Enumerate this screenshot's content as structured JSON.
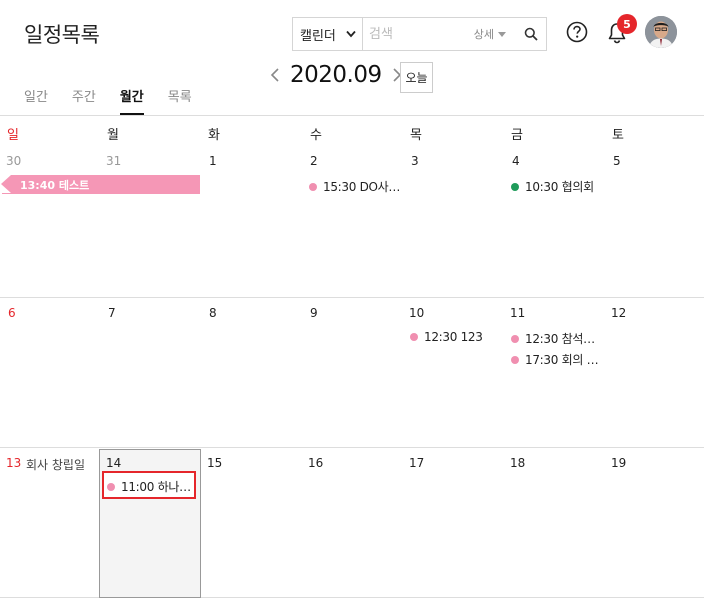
{
  "header": {
    "title": "일정목록",
    "search_scope": "캘린더",
    "search_placeholder": "검색",
    "detail_label": "상세",
    "notification_count": "5"
  },
  "tabs": [
    {
      "label": "일간",
      "active": false
    },
    {
      "label": "주간",
      "active": false
    },
    {
      "label": "월간",
      "active": true
    },
    {
      "label": "목록",
      "active": false
    }
  ],
  "nav": {
    "month": "2020.09",
    "today_label": "오늘"
  },
  "weekdays": [
    "일",
    "월",
    "화",
    "수",
    "목",
    "금",
    "토"
  ],
  "weeks": [
    {
      "days": [
        "30",
        "31",
        "1",
        "2",
        "3",
        "4",
        "5"
      ],
      "bar_event": "13:40 테스트",
      "events": [
        {
          "text": "15:30 DO사…",
          "color": "pink"
        },
        {
          "text": "10:30 협의회",
          "color": "green"
        }
      ]
    },
    {
      "days": [
        "6",
        "7",
        "8",
        "9",
        "10",
        "11",
        "12"
      ],
      "events": [
        {
          "text": "12:30 123",
          "color": "pink"
        },
        {
          "text": "12:30 참석…",
          "color": "pink"
        },
        {
          "text": "17:30 회의 …",
          "color": "pink"
        }
      ]
    },
    {
      "days": [
        "13",
        "14",
        "15",
        "16",
        "17",
        "18",
        "19"
      ],
      "holiday": "회사 창립일",
      "events": [
        {
          "text": "11:00 하나…",
          "color": "pink"
        }
      ]
    }
  ],
  "colors": {
    "accent_red": "#e5262b",
    "event_pink": "#f08fb0",
    "event_green": "#1f9b5a",
    "bar_pink": "#f597b6"
  }
}
